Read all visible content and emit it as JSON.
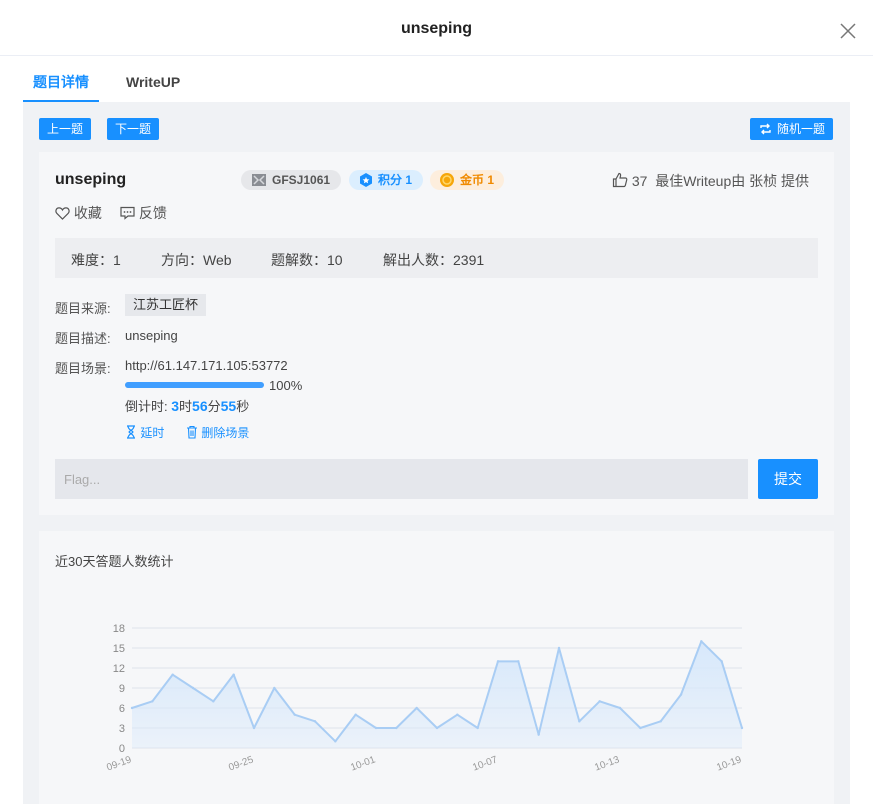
{
  "modal": {
    "title": "unseping"
  },
  "tabs": [
    {
      "label": "题目详情"
    },
    {
      "label": "WriteUP"
    }
  ],
  "toolbar": {
    "prev_label": "上一题",
    "next_label": "下一题",
    "random_label": "随机一题"
  },
  "challenge": {
    "title": "unseping",
    "id_badge": "GFSJ1061",
    "score_badge": "积分 1",
    "gold_badge": "金币 1",
    "likes": "37",
    "writeup_credit": "最佳Writeup由 张桢 提供",
    "favorite_label": "收藏",
    "feedback_label": "反馈",
    "stats": {
      "difficulty": "难度：1",
      "direction": "方向：Web",
      "writeups": "题解数：10",
      "solvers": "解出人数：2391"
    },
    "source_label": "题目来源:",
    "source_value": "江苏工匠杯",
    "desc_label": "题目描述:",
    "desc_value": "unseping",
    "scene_label": "题目场景:",
    "scene_url": "http://61.147.171.105:53772",
    "progress_percent": 100,
    "progress_label": "100%",
    "countdown": {
      "prefix": "倒计时: ",
      "hours": "3",
      "h_unit": "时",
      "minutes": "56",
      "m_unit": "分",
      "seconds": "55",
      "s_unit": "秒"
    },
    "extend_label": "延时",
    "delete_label": "删除场景",
    "flag_placeholder": "Flag...",
    "submit_label": "提交"
  },
  "colors": {
    "accent": "#1890ff",
    "gold": "#f08a00",
    "line": "#a9cdf4",
    "area": "#d7e8fb"
  },
  "chart_data": {
    "type": "area",
    "title": "近30天答题人数统计",
    "x": [
      "09-19",
      "09-20",
      "09-21",
      "09-22",
      "09-23",
      "09-24",
      "09-25",
      "09-26",
      "09-27",
      "09-28",
      "09-29",
      "09-30",
      "10-01",
      "10-02",
      "10-03",
      "10-04",
      "10-05",
      "10-06",
      "10-07",
      "10-08",
      "10-09",
      "10-10",
      "10-11",
      "10-12",
      "10-13",
      "10-14",
      "10-15",
      "10-16",
      "10-17",
      "10-18",
      "10-19"
    ],
    "x_tick_labels": [
      "09-19",
      "09-25",
      "10-01",
      "10-07",
      "10-13",
      "10-19"
    ],
    "values": [
      6,
      7,
      11,
      9,
      7,
      11,
      3,
      9,
      5,
      4,
      1,
      5,
      3,
      3,
      6,
      3,
      5,
      3,
      13,
      13,
      2,
      15,
      4,
      7,
      6,
      3,
      4,
      8,
      16,
      13,
      3
    ],
    "ylim": [
      0,
      18
    ],
    "yticks": [
      0,
      3,
      6,
      9,
      12,
      15,
      18
    ],
    "grid": true
  }
}
